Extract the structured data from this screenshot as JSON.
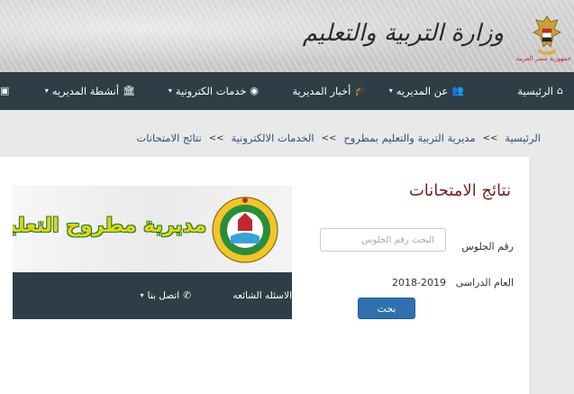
{
  "header": {
    "site_title": "وزارة التربية والتعليم",
    "emblem_caption": "جمهورية مصر العربية"
  },
  "nav": {
    "items": [
      {
        "label": "الرئيسية",
        "icon": "home-icon"
      },
      {
        "label": "عن المديريه",
        "icon": "users-icon"
      },
      {
        "label": "أخبار المديرية",
        "icon": "graduation-cap-icon"
      },
      {
        "label": "خدمات الكترونية",
        "icon": "globe-icon"
      },
      {
        "label": "أنشطة المديريه",
        "icon": "bank-icon"
      }
    ]
  },
  "breadcrumb": {
    "items": [
      "الرئيسية",
      "مديرية التربية والتعليم بمطروح",
      "الخدمات الالكترونية",
      "نتائج الامتحانات"
    ],
    "separator": ">>"
  },
  "page": {
    "title": "نتائج الامتحانات",
    "seat_label": "رقم الجلوس",
    "seat_placeholder": "البحث رقم الجلوس",
    "seat_value": "",
    "year_label": "العام الدراسى",
    "year_value": "2018-2019",
    "search_button": "بحث"
  },
  "banner": {
    "title": "مديرية مطروح التعليمية",
    "nav_items": [
      {
        "label": "الاسئله الشائعه",
        "icon": ""
      },
      {
        "label": "اتصل بنا",
        "icon": "phone-icon"
      }
    ]
  },
  "colors": {
    "nav_bg": "#2f3e46",
    "title_red": "#7a1f1f",
    "link_blue": "#2c4f7c",
    "button_blue": "#2f6fae"
  }
}
